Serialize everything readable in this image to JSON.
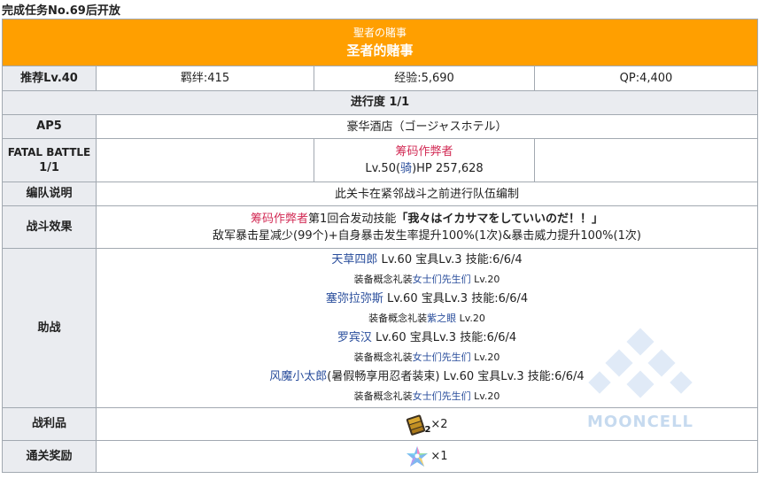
{
  "unlock_note": "完成任务No.69后开放",
  "quest": {
    "title_jp": "聖者の賭事",
    "title_cn": "圣者的赌事"
  },
  "rewards_row": {
    "label": "推荐Lv.40",
    "bond": "羁绊:415",
    "exp": "经验:5,690",
    "qp": "QP:4,400"
  },
  "progress": "进行度 1/1",
  "ap_row": {
    "label": "AP5",
    "location": "豪华酒店（ゴージャスホテル）"
  },
  "battle_row": {
    "label_line1": "FATAL BATTLE",
    "label_line2": "1/1",
    "enemy_name": "筹码作弊者",
    "enemy_level_prefix": "Lv.50(",
    "enemy_class": "骑",
    "enemy_hp": ")HP 257,628"
  },
  "formation_row": {
    "label": "编队说明",
    "text": "此关卡在紧邻战斗之前进行队伍编制"
  },
  "effect_row": {
    "label": "战斗效果",
    "enemy": "筹码作弊者",
    "skill_prefix": "第1回合发动技能",
    "skill_name": "「我々はイカサマをしていいのだ！！」",
    "line2": "敌军暴击星减少(99个)+自身暴击发生率提升100%(1次)&暴击威力提升100%(1次)"
  },
  "support_row": {
    "label": "助战",
    "entries": [
      {
        "name": "天草四郎",
        "stats": " Lv.60 宝具Lv.3 技能:6/6/4",
        "ce_prefix": "装备概念礼装",
        "ce_name": "女士们先生们",
        "ce_level": " Lv.20"
      },
      {
        "name": "塞弥拉弥斯",
        "stats": " Lv.60 宝具Lv.3 技能:6/6/4",
        "ce_prefix": "装备概念礼装",
        "ce_name": "紫之眼",
        "ce_level": " Lv.20"
      },
      {
        "name": "罗宾汉",
        "stats": " Lv.60 宝具Lv.3 技能:6/6/4",
        "ce_prefix": "装备概念礼装",
        "ce_name": "女士们先生们",
        "ce_level": " Lv.20"
      },
      {
        "name": "风魔小太郎",
        "stats": "(暑假畅享用忍者装束) Lv.60 宝具Lv.3 技能:6/6/4",
        "ce_prefix": "装备概念礼装",
        "ce_name": "女士们先生们",
        "ce_level": " Lv.20"
      }
    ]
  },
  "drops_row": {
    "label": "战利品",
    "item_icon": "gold-ingot-chest-icon",
    "item_badge": "2",
    "item_qty": "×2"
  },
  "clear_row": {
    "label": "通关奖励",
    "item_icon": "rainbow-star-icon",
    "item_qty": "×1"
  },
  "watermark": "MOONCELL",
  "colors": {
    "header_bg": "#ff9f00",
    "header_text": "#ffffff",
    "label_bg": "#eaecf0",
    "border": "#a2a9b1",
    "enemy_red": "#d22a54",
    "link_blue": "#2a4e9c"
  }
}
